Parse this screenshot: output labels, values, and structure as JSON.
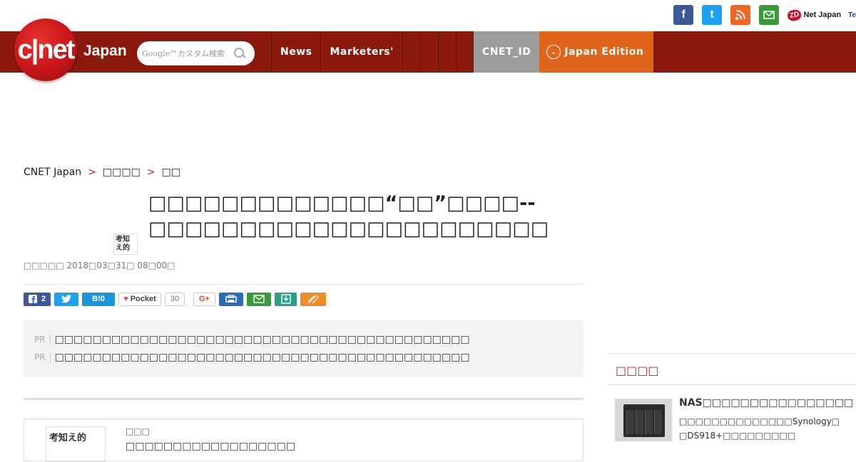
{
  "header": {
    "logo_text": "c|net",
    "logo_sub": "Japan",
    "search_placeholder": "Google™カスタム検索",
    "social": {
      "facebook": "f",
      "twitter": "t",
      "zdnet_badge": "ZD",
      "zdnet_label": "Net Japan",
      "tech_label": "Te"
    }
  },
  "nav": {
    "items": [
      "News",
      "Marketers'"
    ],
    "cnet_id": "CNET_ID",
    "edition": "Japan Edition"
  },
  "breadcrumb": {
    "items": [
      "CNET Japan",
      "□□□□",
      "□□"
    ],
    "separator": ">"
  },
  "article": {
    "title": "□□□□□□□□□□□□□“□□”□□□□--□□□□□□□□□□□□□□□□□□□□□□",
    "thumb_text": "考知え的",
    "byline": "□□□□□ 2018□03□31□ 08□00□",
    "share": {
      "facebook_count": "2",
      "hatena_label": "B!0",
      "pocket_label": "Pocket",
      "pocket_count": "30",
      "gplus_label": "G+"
    }
  },
  "pr": {
    "tag": "PR",
    "items": [
      "□□□□□□□□□□□□□□□□□□□□□□□□□□□□□□□□□□□□□□□□□□□□",
      "□□□□□□□□□□□□□□□□□□□□□□□□□□□□□□□□□□□□□□□□□□□□"
    ]
  },
  "book_card": {
    "thumb_text": "考知え的",
    "label": "□□□",
    "title": "□□□□□□□□□□□□□□□□□□"
  },
  "sidebar": {
    "heading": "□□□□",
    "item_title": "NAS□□□□□□□□□□□□□□□□",
    "item_desc_1": "□□□□□□□□□□□□□□Synology□",
    "item_desc_2": "□DS918+□□□□□□□□□"
  }
}
